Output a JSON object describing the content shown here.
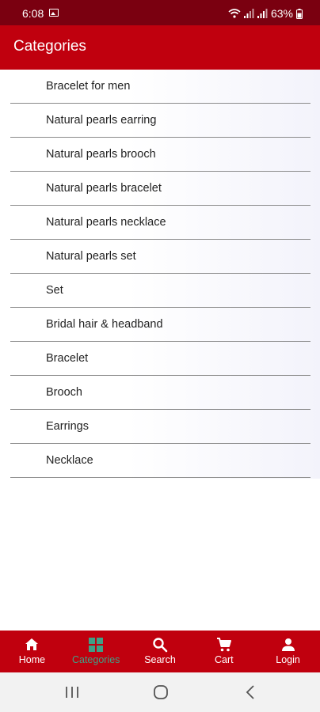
{
  "status_bar": {
    "time": "6:08",
    "battery": "63%",
    "icons": [
      "gallery-icon",
      "wifi-icon",
      "signal-icon",
      "signal-icon",
      "battery-icon"
    ]
  },
  "app_bar": {
    "title": "Categories"
  },
  "categories": [
    {
      "label": "Bracelet for men"
    },
    {
      "label": "Natural pearls earring"
    },
    {
      "label": "Natural pearls brooch"
    },
    {
      "label": "Natural pearls bracelet"
    },
    {
      "label": "Natural pearls necklace"
    },
    {
      "label": "Natural pearls set"
    },
    {
      "label": "Set"
    },
    {
      "label": "Bridal hair & headband"
    },
    {
      "label": "Bracelet"
    },
    {
      "label": "Brooch"
    },
    {
      "label": "Earrings"
    },
    {
      "label": "Necklace"
    }
  ],
  "bottom_nav": {
    "active": "Categories",
    "items": [
      {
        "label": "Home",
        "icon": "home-icon"
      },
      {
        "label": "Categories",
        "icon": "grid-icon"
      },
      {
        "label": "Search",
        "icon": "search-icon"
      },
      {
        "label": "Cart",
        "icon": "cart-icon"
      },
      {
        "label": "Login",
        "icon": "person-icon"
      }
    ]
  },
  "system_nav": {
    "buttons": [
      "recents-icon",
      "home-circle-icon",
      "back-icon"
    ]
  },
  "colors": {
    "status_bar": "#7a0010",
    "primary": "#c0000e",
    "active_nav": "#3fa086",
    "divider": "#8a8a8a"
  }
}
